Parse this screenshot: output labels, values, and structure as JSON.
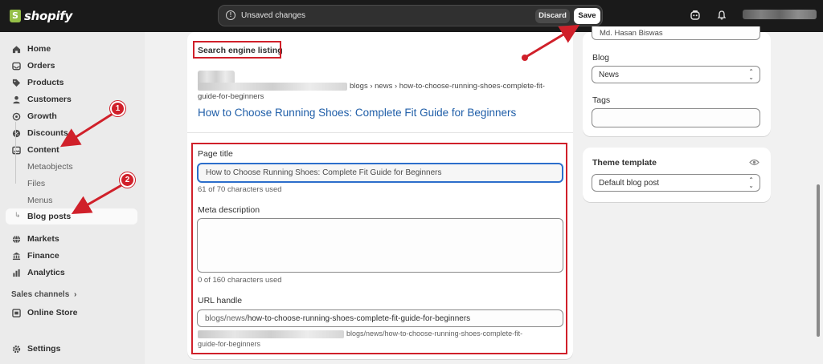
{
  "brand": {
    "name": "shopify"
  },
  "top_bar": {
    "unsaved_text": "Unsaved changes",
    "discard_label": "Discard",
    "save_label": "Save"
  },
  "sidebar": {
    "items": [
      {
        "label": "Home",
        "icon": "home-icon"
      },
      {
        "label": "Orders",
        "icon": "inbox-icon"
      },
      {
        "label": "Products",
        "icon": "tag-icon"
      },
      {
        "label": "Customers",
        "icon": "person-icon"
      },
      {
        "label": "Growth",
        "icon": "target-icon"
      },
      {
        "label": "Discounts",
        "icon": "discount-icon"
      },
      {
        "label": "Content",
        "icon": "image-icon"
      }
    ],
    "content_subitems": [
      "Metaobjects",
      "Files",
      "Menus",
      "Blog posts"
    ],
    "more_items": [
      {
        "label": "Markets",
        "icon": "globe-icon"
      },
      {
        "label": "Finance",
        "icon": "bank-icon"
      },
      {
        "label": "Analytics",
        "icon": "chart-icon"
      }
    ],
    "sales_channels_label": "Sales channels",
    "online_store_label": "Online Store",
    "settings_label": "Settings"
  },
  "seo": {
    "heading": "Search engine listing",
    "preview_breadcrumb": "blogs › news › how-to-choose-running-shoes-complete-fit-",
    "preview_breadcrumb_line2": "guide-for-beginners",
    "preview_title": "How to Choose Running Shoes: Complete Fit Guide for Beginners",
    "page_title_label": "Page title",
    "page_title_value": "How to Choose Running Shoes: Complete Fit Guide for Beginners",
    "page_title_count": "61 of 70 characters used",
    "meta_description_label": "Meta description",
    "meta_description_value": "",
    "meta_description_count": "0 of 160 characters used",
    "url_handle_label": "URL handle",
    "url_handle_prefix": "blogs/news/",
    "url_handle_value": "how-to-choose-running-shoes-complete-fit-guide-for-beginners",
    "url_preview": "blogs/news/how-to-choose-running-shoes-complete-fit-",
    "url_preview_line2": "guide-for-beginners"
  },
  "right": {
    "author_value": "Md. Hasan Biswas",
    "blog_label": "Blog",
    "blog_value": "News",
    "tags_label": "Tags",
    "tags_value": "",
    "theme_template_label": "Theme template",
    "theme_template_value": "Default blog post"
  },
  "annotations": {
    "badge1": "1",
    "badge2": "2"
  },
  "colors": {
    "accent": "#2c6ecb",
    "annotation": "#d0202a",
    "topbar": "#1a1a1a"
  }
}
